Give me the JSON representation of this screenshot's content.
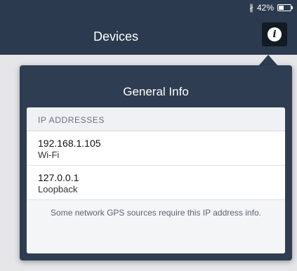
{
  "status": {
    "bluetooth_icon": "bluetooth-icon",
    "battery_text": "42%",
    "battery_level": 0.42
  },
  "nav": {
    "title": "Devices",
    "info_icon": "info-icon"
  },
  "popover": {
    "title": "General Info",
    "section_header": "IP ADDRESSES",
    "addresses": [
      {
        "ip": "192.168.1.105",
        "type": "Wi-Fi"
      },
      {
        "ip": "127.0.0.1",
        "type": "Loopback"
      }
    ],
    "footer": "Some network GPS sources require this IP address info."
  },
  "colors": {
    "navbar": "#2b3a4e",
    "popover": "#2f3d52",
    "info_button": "#121a24"
  }
}
